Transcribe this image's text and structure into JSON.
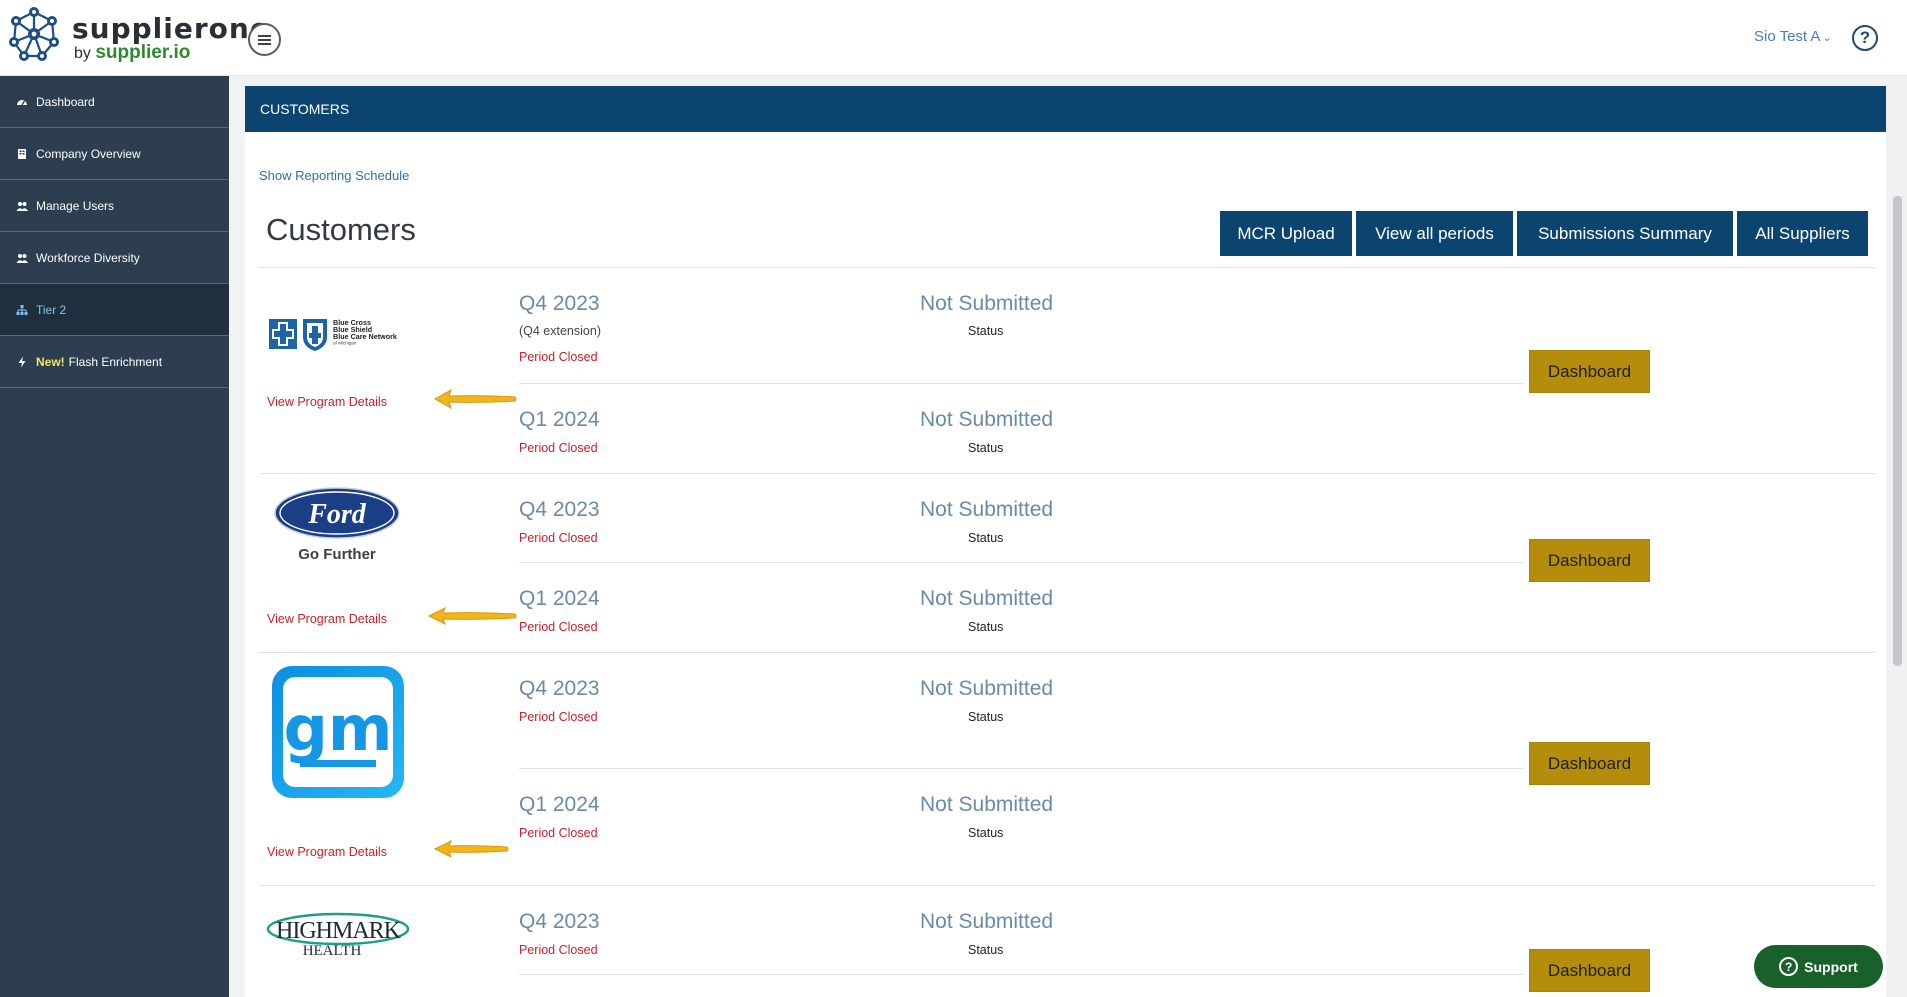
{
  "brand": {
    "name": "supplierone",
    "by": "by",
    "domain": "supplier.io"
  },
  "header": {
    "user": "Sio Test A",
    "user_caret": "⌄",
    "help": "?"
  },
  "sidebar": {
    "items": [
      {
        "label": "Dashboard",
        "icon": "dashboard-icon"
      },
      {
        "label": "Company Overview",
        "icon": "building-icon"
      },
      {
        "label": "Manage Users",
        "icon": "users-icon"
      },
      {
        "label": "Workforce Diversity",
        "icon": "users-icon"
      },
      {
        "label": "Tier 2",
        "icon": "sitemap-icon",
        "active": true
      },
      {
        "label": "Flash Enrichment",
        "new": "New!",
        "icon": "bolt-icon"
      }
    ]
  },
  "panel": {
    "header": "CUSTOMERS",
    "show_schedule": "Show Reporting Schedule",
    "title": "Customers",
    "buttons": [
      "MCR Upload",
      "View all periods",
      "Submissions Summary",
      "All Suppliers"
    ]
  },
  "customers": [
    {
      "logo": "blue-cross-logo",
      "logo_text": [
        "Blue Cross",
        "Blue Shield",
        "Blue Care Network",
        "of Michigan"
      ],
      "program_link": "View Program Details",
      "dashboard": "Dashboard",
      "periods": [
        {
          "label": "Q4 2023",
          "extension": "(Q4 extension)",
          "closed": "Period Closed",
          "status": "Not Submitted",
          "status_label": "Status"
        },
        {
          "label": "Q1 2024",
          "closed": "Period Closed",
          "status": "Not Submitted",
          "status_label": "Status"
        }
      ]
    },
    {
      "logo": "ford-logo",
      "logo_text": [
        "Ford",
        "Go Further"
      ],
      "program_link": "View Program Details",
      "dashboard": "Dashboard",
      "periods": [
        {
          "label": "Q4 2023",
          "closed": "Period Closed",
          "status": "Not Submitted",
          "status_label": "Status"
        },
        {
          "label": "Q1 2024",
          "closed": "Period Closed",
          "status": "Not Submitted",
          "status_label": "Status"
        }
      ]
    },
    {
      "logo": "gm-logo",
      "logo_text": [
        "gm"
      ],
      "program_link": "View Program Details",
      "dashboard": "Dashboard",
      "periods": [
        {
          "label": "Q4 2023",
          "closed": "Period Closed",
          "status": "Not Submitted",
          "status_label": "Status"
        },
        {
          "label": "Q1 2024",
          "closed": "Period Closed",
          "status": "Not Submitted",
          "status_label": "Status"
        }
      ]
    },
    {
      "logo": "highmark-logo",
      "logo_text": [
        "HIGHMARK",
        "HEALTH"
      ],
      "dashboard": "Dashboard",
      "periods": [
        {
          "label": "Q4 2023",
          "closed": "Period Closed",
          "status": "Not Submitted",
          "status_label": "Status"
        }
      ]
    }
  ],
  "support": {
    "label": "Support",
    "icon": "question-icon"
  },
  "colors": {
    "navy": "#0c4470",
    "sidebar": "#2c3e50",
    "gold": "#b58d0c",
    "red": "#c4232b",
    "arrow": "#f2b51c"
  }
}
